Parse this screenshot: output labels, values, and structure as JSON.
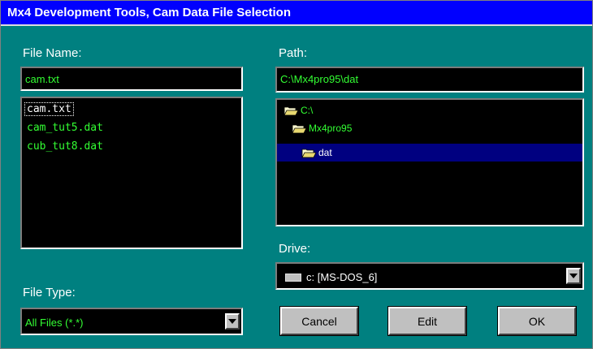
{
  "window": {
    "title": "Mx4 Development Tools, Cam Data File Selection"
  },
  "file_name": {
    "label": "File Name:",
    "value": "cam.txt",
    "files": [
      "cam.txt",
      "cam_tut5.dat",
      "cub_tut8.dat"
    ],
    "selected_index": 0
  },
  "path": {
    "label": "Path:",
    "value": "C:\\Mx4pro95\\dat",
    "tree": [
      {
        "label": "C:\\",
        "icon": "open-folder-icon",
        "depth": 0,
        "selected": false
      },
      {
        "label": "Mx4pro95",
        "icon": "open-folder-icon",
        "depth": 1,
        "selected": false
      },
      {
        "label": "dat",
        "icon": "open-folder-icon",
        "depth": 2,
        "selected": true
      }
    ]
  },
  "drive": {
    "label": "Drive:",
    "value": "c: [MS-DOS_6]",
    "icon": "hard-drive-icon"
  },
  "file_type": {
    "label": "File Type:",
    "value": "All Files (*.*)"
  },
  "buttons": {
    "cancel": "Cancel",
    "edit": "Edit",
    "ok": "OK"
  },
  "colors": {
    "background": "#008080",
    "title_bar": "#0000ff",
    "field_text": "#33ff33",
    "selection": "#000080"
  }
}
